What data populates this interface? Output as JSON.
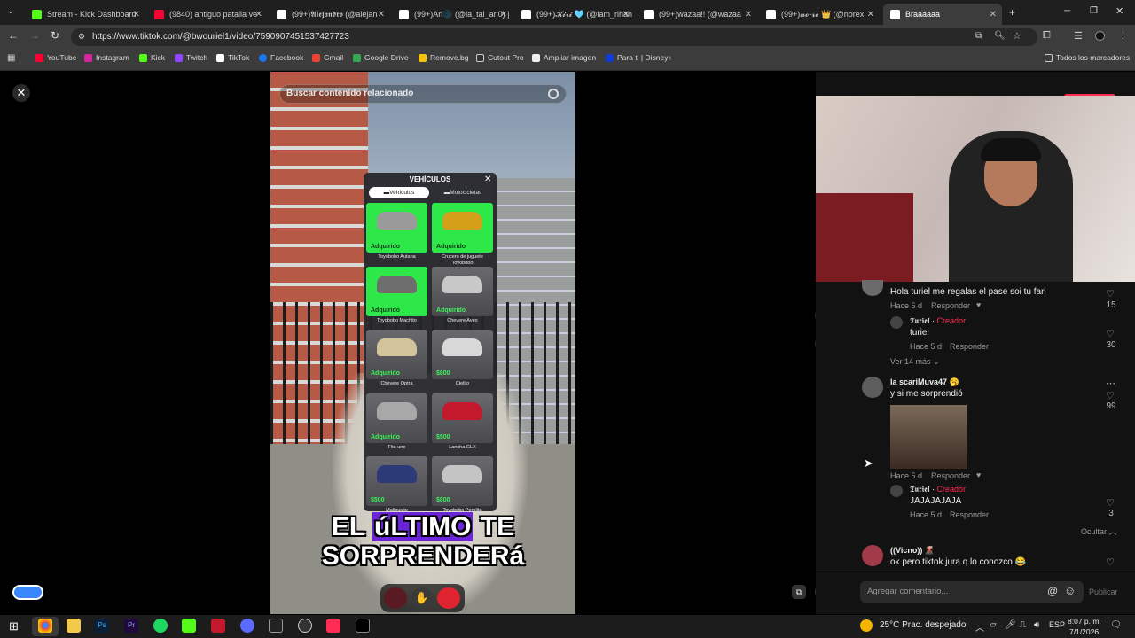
{
  "browser": {
    "tabs": [
      {
        "title": "Stream - Kick Dashboard",
        "color": "#53fc18"
      },
      {
        "title": "(9840) antiguo patalla ve",
        "color": "#ff0033"
      },
      {
        "title": "(99+)𝕬𝖑𝖊𝖏𝖆𝖓𝖉𝖗𝖔 (@alejan",
        "color": "#ffffff"
      },
      {
        "title": "(99+)Ari🌑 (@la_tal_ari0) |",
        "color": "#ffffff"
      },
      {
        "title": "(99+)𝓚𝓲𝓻𝓲 🩵 (@iam_rihan",
        "color": "#ffffff"
      },
      {
        "title": "(99+)wazaa!! (@wazaa",
        "color": "#ffffff"
      },
      {
        "title": "(99+)𝓷𝓸-𝓻𝓮 👑 (@norex",
        "color": "#ffffff"
      },
      {
        "title": "Braaaaaa",
        "color": "#ffffff"
      }
    ],
    "new_tab": "+",
    "url": "https://www.tiktok.com/@bwouriel1/video/7590907451537427723",
    "bookmarks": [
      "YouTube",
      "Instagram",
      "Kick",
      "Twitch",
      "TikTok",
      "Facebook",
      "Gmail",
      "Google Drive",
      "Remove.bg",
      "Cutout Pro",
      "Ampliar imagen",
      "Para ti | Disney+"
    ],
    "all_bookmarks": "Todos los marcadores"
  },
  "video": {
    "search_placeholder": "Buscar contenido relacionado",
    "menu": {
      "title": "VEHÍCULOS",
      "tabs": [
        "Vehículos",
        "Motocicletas"
      ],
      "items": [
        {
          "name": "Toyobobo Autana",
          "status": "Adquirido",
          "owned": true,
          "car": "#9a9a9a"
        },
        {
          "name": "Crucero de juguete Toyobobo",
          "status": "Adquirido",
          "owned": true,
          "car": "#d4a01a"
        },
        {
          "name": "Toyobobo Machito",
          "status": "Adquirido",
          "owned": true,
          "car": "#6e6e6e"
        },
        {
          "name": "Chevere Aveo",
          "status": "Adquirido",
          "owned": false,
          "car": "#c8c8c8"
        },
        {
          "name": "Chevere Optra",
          "status": "Adquirido",
          "owned": false,
          "car": "#d2c49a"
        },
        {
          "name": "Cielito",
          "status": "$800",
          "owned": false,
          "car": "#d8d8d8"
        },
        {
          "name": "Fita uno",
          "status": "Adquirido",
          "owned": false,
          "car": "#a8a8a8"
        },
        {
          "name": "Lancha GLX",
          "status": "$500",
          "owned": false,
          "car": "#c4182c"
        },
        {
          "name": "Malibusito",
          "status": "$500",
          "owned": false,
          "car": "#2d3a78"
        },
        {
          "name": "Toyobobo Perolita",
          "status": "$800",
          "owned": false,
          "car": "#c4c4c4"
        }
      ]
    },
    "caption_line1_a": "EL ",
    "caption_line1_hl": "úLTIMO",
    "caption_line1_b": " TE",
    "caption_line2": "SORPRENDERá"
  },
  "comments": [
    {
      "text": "Hola turiel me regalas el pase soi tu fan",
      "meta": "Hace 5 d",
      "reply": "Responder",
      "likes": "15"
    },
    {
      "author": "𝕿𝖚𝖗𝖎𝖊𝖑",
      "badge": "Creador",
      "text": "turiel",
      "meta": "Hace 5 d",
      "reply": "Responder",
      "likes": "30"
    },
    {
      "more": "Ver 14 más"
    },
    {
      "author": "la scariMuva47 🥱",
      "text": "y si me sorprendió",
      "meta": "Hace 5 d",
      "reply": "Responder",
      "likes": "99"
    },
    {
      "author": "𝕿𝖚𝖗𝖎𝖊𝖑",
      "badge": "Creador",
      "text": "JAJAJAJAJA",
      "meta": "Hace 5 d",
      "reply": "Responder",
      "likes": "3"
    },
    {
      "hide": "Ocultar"
    },
    {
      "author": "((Vicno)) 🌋",
      "text": "ok pero tiktok jura q lo conozco 😂"
    }
  ],
  "add_comment_placeholder": "Agregar comentario...",
  "publish": "Publicar",
  "taskbar": {
    "weather": "25°C  Prac. despejado",
    "lang": "ESP",
    "time": "8:07 p. m.",
    "date": "7/1/2026"
  },
  "colors": {
    "accent": "#fe2c55",
    "owned": "#2ee84a"
  }
}
